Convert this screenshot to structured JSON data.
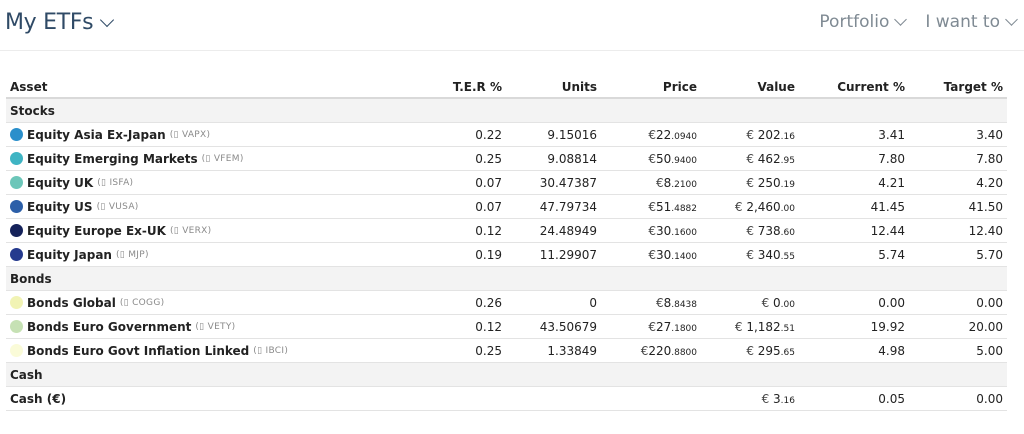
{
  "header": {
    "title": "My ETFs",
    "nav": [
      "Portfolio",
      "I want to"
    ]
  },
  "table": {
    "columns": [
      "Asset",
      "T.E.R %",
      "Units",
      "Price",
      "Value",
      "Current %",
      "Target %"
    ],
    "sections": [
      {
        "name": "Stocks",
        "rows": [
          {
            "name": "Equity Asia Ex-Japan",
            "ticker": "VAPX",
            "color": "#2a8fcb",
            "ter": "0.22",
            "units": "9.15016",
            "price_main": "22",
            "price_cents": ".0940",
            "value_main": "202",
            "value_cents": ".16",
            "current": "3.41",
            "target": "3.40"
          },
          {
            "name": "Equity Emerging Markets",
            "ticker": "VFEM",
            "color": "#3fb4c3",
            "ter": "0.25",
            "units": "9.08814",
            "price_main": "50",
            "price_cents": ".9400",
            "value_main": "462",
            "value_cents": ".95",
            "current": "7.80",
            "target": "7.80"
          },
          {
            "name": "Equity UK",
            "ticker": "ISFA",
            "color": "#6cc6b9",
            "ter": "0.07",
            "units": "30.47387",
            "price_main": "8",
            "price_cents": ".2100",
            "value_main": "250",
            "value_cents": ".19",
            "current": "4.21",
            "target": "4.20"
          },
          {
            "name": "Equity US",
            "ticker": "VUSA",
            "color": "#2c5fa8",
            "ter": "0.07",
            "units": "47.79734",
            "price_main": "51",
            "price_cents": ".4882",
            "value_main": "2,460",
            "value_cents": ".00",
            "current": "41.45",
            "target": "41.50"
          },
          {
            "name": "Equity Europe Ex-UK",
            "ticker": "VERX",
            "color": "#15225a",
            "ter": "0.12",
            "units": "24.48949",
            "price_main": "30",
            "price_cents": ".1600",
            "value_main": "738",
            "value_cents": ".60",
            "current": "12.44",
            "target": "12.40"
          },
          {
            "name": "Equity Japan",
            "ticker": "MJP",
            "color": "#253a8e",
            "ter": "0.19",
            "units": "11.29907",
            "price_main": "30",
            "price_cents": ".1400",
            "value_main": "340",
            "value_cents": ".55",
            "current": "5.74",
            "target": "5.70"
          }
        ]
      },
      {
        "name": "Bonds",
        "rows": [
          {
            "name": "Bonds Global",
            "ticker": "COGG",
            "color": "#f1f3b4",
            "ter": "0.26",
            "units": "0",
            "price_main": "8",
            "price_cents": ".8438",
            "value_main": "0",
            "value_cents": ".00",
            "current": "0.00",
            "target": "0.00"
          },
          {
            "name": "Bonds Euro Government",
            "ticker": "VETY",
            "color": "#c6e1b4",
            "ter": "0.12",
            "units": "43.50679",
            "price_main": "27",
            "price_cents": ".1800",
            "value_main": "1,182",
            "value_cents": ".51",
            "current": "19.92",
            "target": "20.00"
          },
          {
            "name": "Bonds Euro Govt Inflation Linked",
            "ticker": "IBCI",
            "color": "#fafbd8",
            "ter": "0.25",
            "units": "1.33849",
            "price_main": "220",
            "price_cents": ".8800",
            "value_main": "295",
            "value_cents": ".65",
            "current": "4.98",
            "target": "5.00"
          }
        ]
      },
      {
        "name": "Cash",
        "rows": [
          {
            "name": "Cash (€)",
            "ticker": "",
            "color": "",
            "ter": "",
            "units": "",
            "price_main": "",
            "price_cents": "",
            "value_main": "3",
            "value_cents": ".16",
            "current": "0.05",
            "target": "0.00"
          }
        ]
      }
    ]
  }
}
